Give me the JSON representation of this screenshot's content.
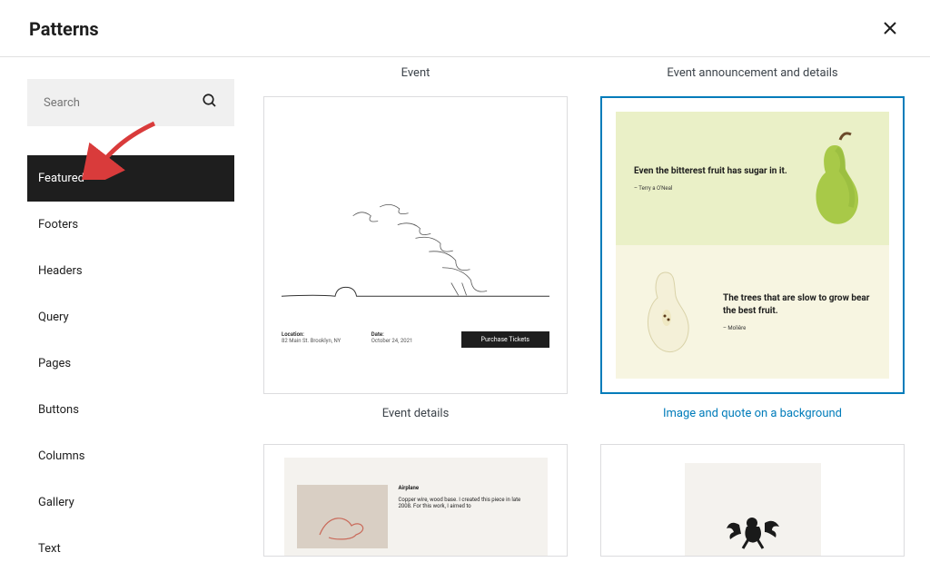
{
  "header": {
    "title": "Patterns"
  },
  "search": {
    "placeholder": "Search"
  },
  "sidebar": {
    "items": [
      "Featured",
      "Footers",
      "Headers",
      "Query",
      "Pages",
      "Buttons",
      "Columns",
      "Gallery",
      "Text"
    ],
    "active_index": 0
  },
  "top_row": {
    "label1": "Event",
    "label2": "Event announcement and details"
  },
  "cards": {
    "event_details": {
      "label": "Event details",
      "location_label": "Location:",
      "location_value": "82 Main St. Brooklyn, NY",
      "date_label": "Date:",
      "date_value": "October 24, 2021",
      "button": "Purchase Tickets"
    },
    "image_quote": {
      "label": "Image and quote on a background",
      "quote1": "Even the bitterest fruit has sugar in it.",
      "attr1": "– Terry a O'Neal",
      "quote2": "The trees that are slow to grow bear the best fruit.",
      "attr2": "– Molière"
    },
    "airplane": {
      "title": "Airplane",
      "desc": "Copper wire, wood base. I created this piece in late 2008. For this work, I aimed to"
    }
  }
}
